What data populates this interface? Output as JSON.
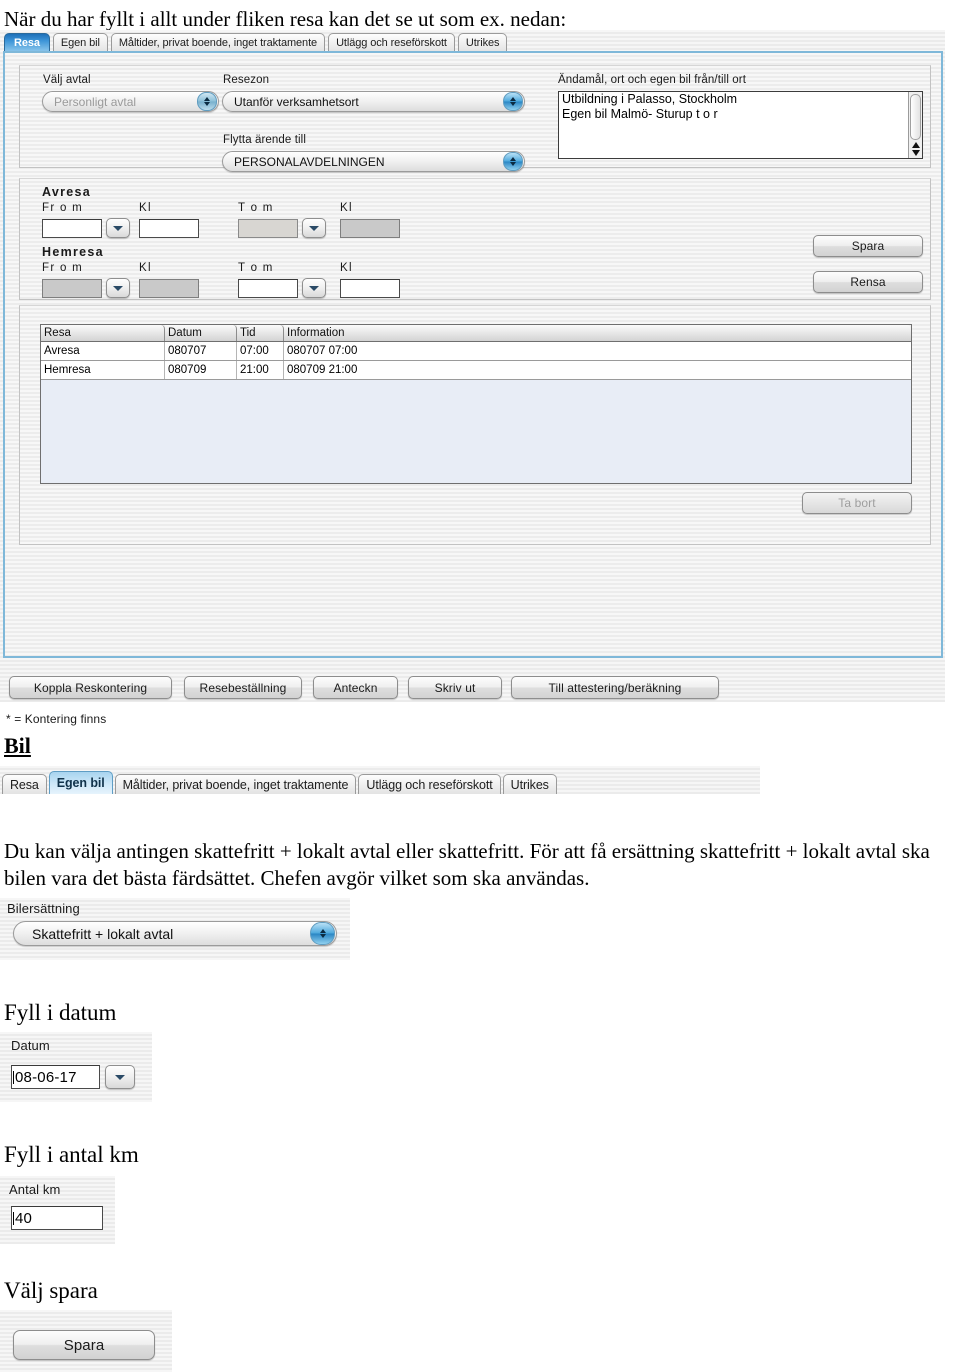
{
  "doc": {
    "intro": "När du har fyllt i allt under fliken resa kan det se ut som ex. nedan:",
    "heading_bil": "Bil",
    "paragraph": "Du kan välja antingen skattefritt + lokalt avtal eller skattefritt. För att få ersättning skattefritt + lokalt avtal ska bilen vara det bästa färdsättet. Chefen avgör vilket som ska användas.",
    "heading_datum": "Fyll i datum",
    "heading_antal_km": "Fyll i antal km",
    "heading_valj_spara": "Välj spara"
  },
  "tabs_resa": [
    {
      "label": "Resa",
      "state": "selected-blue"
    },
    {
      "label": "Egen bil",
      "state": "normal"
    },
    {
      "label": "Måltider, privat boende, inget traktamente",
      "state": "normal"
    },
    {
      "label": "Utlägg och reseförskott",
      "state": "normal"
    },
    {
      "label": "Utrikes",
      "state": "normal"
    }
  ],
  "tabs_bil": [
    {
      "label": "Resa",
      "state": "normal"
    },
    {
      "label": "Egen bil",
      "state": "selected"
    },
    {
      "label": "Måltider, privat boende, inget traktamente",
      "state": "normal"
    },
    {
      "label": "Utlägg och reseförskott",
      "state": "normal"
    },
    {
      "label": "Utrikes",
      "state": "normal"
    }
  ],
  "resa_form": {
    "valj_avtal": {
      "label": "Välj avtal",
      "value": "Personligt avtal",
      "disabled": true
    },
    "resezon": {
      "label": "Resezon",
      "value": "Utanför verksamhetsort"
    },
    "flytta_arende": {
      "label": "Flytta ärende till",
      "value": "PERSONALAVDELNINGEN"
    },
    "andamal": {
      "label": "Ändamål, ort och egen bil från/till ort",
      "lines": [
        "Utbildning i Palasso, Stockholm",
        "Egen bil Malmö- Sturup t o r"
      ]
    },
    "avresa": {
      "title": "Avresa",
      "from_label": "Fr o m",
      "from_time_label": "Kl",
      "to_label": "T o m",
      "to_time_label": "Kl",
      "from_value": "",
      "from_time_value": "",
      "to_value": "",
      "to_time_value": ""
    },
    "hemresa": {
      "title": "Hemresa",
      "from_label": "Fr o m",
      "from_time_label": "Kl",
      "to_label": "T o m",
      "to_time_label": "Kl",
      "from_value": "",
      "from_time_value": "",
      "to_value": "",
      "to_time_value": ""
    },
    "spara_button": "Spara",
    "rensa_button": "Rensa",
    "ta_bort_button": "Ta bort"
  },
  "resa_grid": {
    "columns": [
      "Resa",
      "Datum",
      "Tid",
      "Information"
    ],
    "rows": [
      [
        "Avresa",
        "080707",
        "07:00",
        "080707 07:00"
      ],
      [
        "Hemresa",
        "080709",
        "21:00",
        "080709 21:00"
      ]
    ]
  },
  "bottom_toolbar": {
    "buttons": [
      "Koppla Reskontering",
      "Resebeställning",
      "Anteckn",
      "Skriv ut",
      "Till attestering/beräkning"
    ],
    "footnote": "* = Kontering finns"
  },
  "bil_form": {
    "bilersattning": {
      "label": "Bilersättning",
      "value": "Skattefritt + lokalt avtal"
    },
    "datum": {
      "label": "Datum",
      "value": "08-06-17"
    },
    "antal_km": {
      "label": "Antal km",
      "value": "40"
    },
    "spara_button": "Spara"
  },
  "colors": {
    "panel_border": "#7fb8d9",
    "tab_active": "#2a86c4",
    "combo_arrow": "#2a86c4",
    "grid_blank": "#e8edf6"
  }
}
